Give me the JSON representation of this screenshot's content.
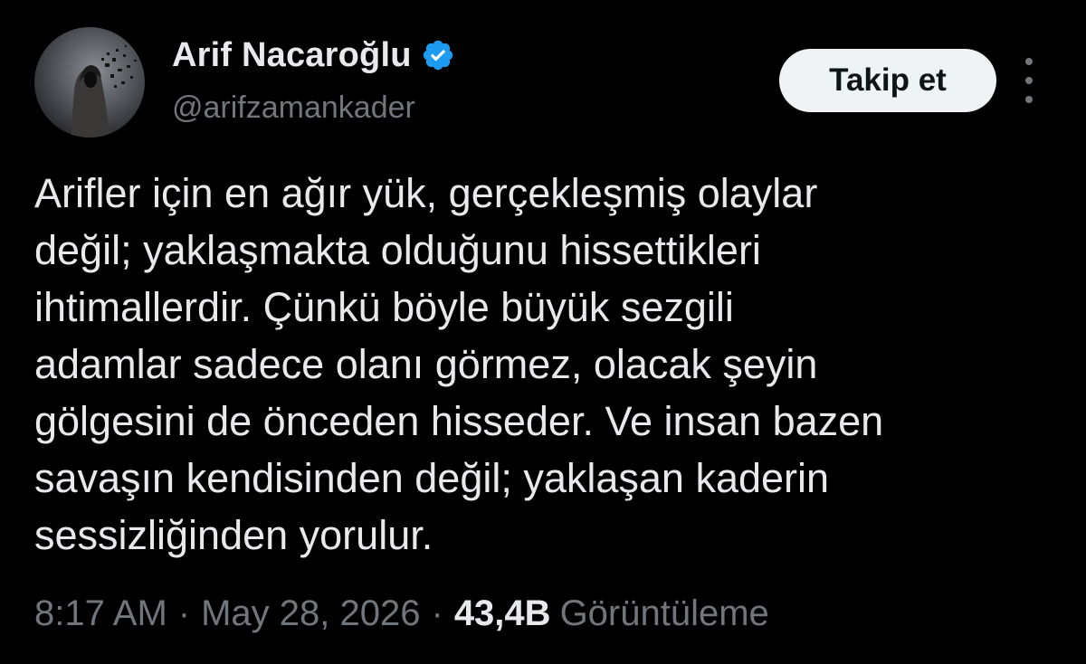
{
  "author": {
    "display_name": "Arif Nacaroğlu",
    "handle": "@arifzamankader",
    "verified_icon": "verified-badge-icon",
    "verified_color": "#1d9bf0"
  },
  "actions": {
    "follow_label": "Takip et",
    "more_icon": "more-vertical-icon"
  },
  "tweet": {
    "lines": [
      "Arifler için en ağır yük, gerçekleşmiş olaylar",
      "değil; yaklaşmakta olduğunu hissettikleri",
      "ihtimallerdir. Çünkü böyle büyük sezgili",
      "adamlar sadece olanı görmez, olacak şeyin",
      "gölgesini de önceden hisseder. Ve insan bazen",
      "savaşın kendisinden değil; yaklaşan kaderin",
      "sessizliğinden yorulur."
    ]
  },
  "meta": {
    "time": "8:17 AM",
    "separator": "·",
    "date": "May 28, 2026",
    "views_count": "43,4B",
    "views_label": "Görüntüleme"
  },
  "colors": {
    "background": "#000000",
    "primary_text": "#e7e9ea",
    "secondary_text": "#71767b",
    "follow_button_bg": "#eff3f4"
  }
}
